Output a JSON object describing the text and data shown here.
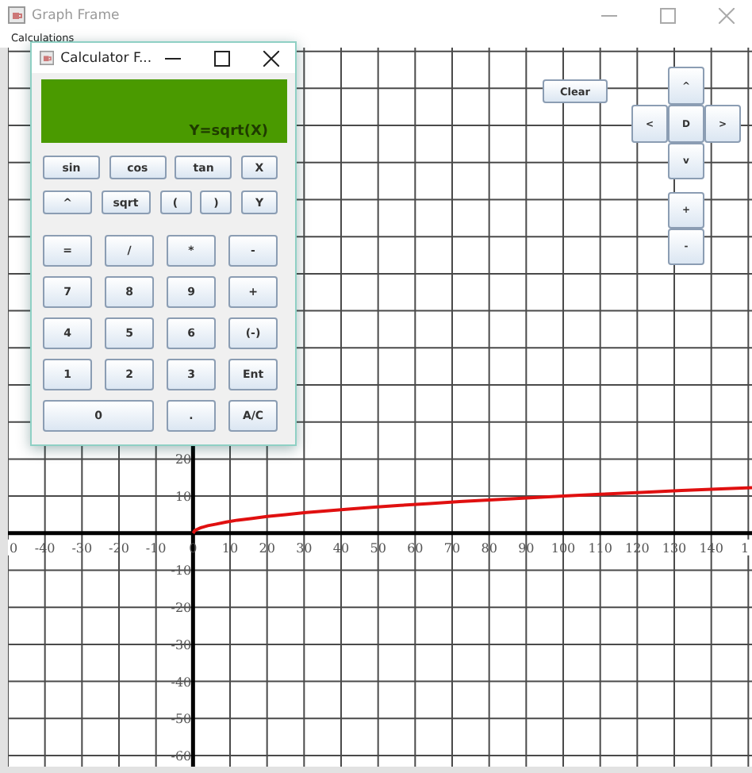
{
  "graph_window": {
    "title": "Graph Frame",
    "menu": [
      "Calculations"
    ],
    "plot": {
      "cut_tick_labels": [
        {
          "label": "0",
          "kind": "left"
        },
        {
          "label": "1",
          "kind": "right"
        }
      ],
      "chart_data": {
        "type": "line",
        "grid": true,
        "xlim": [
          -50,
          151
        ],
        "ylim": [
          -63,
          131
        ],
        "xticks": [
          -40,
          -30,
          -20,
          -10,
          0,
          10,
          20,
          30,
          40,
          50,
          60,
          70,
          80,
          90,
          100,
          110,
          120,
          130,
          140
        ],
        "yticks": [
          -60,
          -50,
          -40,
          -30,
          -20,
          -10,
          10,
          20
        ],
        "x": [
          0,
          0.5,
          1,
          2,
          4,
          6,
          9,
          12,
          16,
          20,
          25,
          30,
          36,
          42,
          49,
          56,
          64,
          72,
          81,
          90,
          100,
          110,
          121,
          132,
          144,
          151
        ],
        "series": [
          {
            "color": "#e01010",
            "values": [
              0,
              0.7,
              1,
              1.4,
              2,
              2.4,
              3,
              3.5,
              4,
              4.5,
              5,
              5.5,
              6,
              6.5,
              7,
              7.5,
              8,
              8.5,
              9,
              9.5,
              10,
              10.5,
              11,
              11.5,
              12,
              12.3
            ]
          }
        ]
      }
    },
    "clear_button": "Clear",
    "pad_buttons": [
      {
        "label": "^",
        "kind": "up"
      },
      {
        "label": "<",
        "kind": "left"
      },
      {
        "label": "D",
        "kind": "center"
      },
      {
        "label": ">",
        "kind": "right"
      },
      {
        "label": "v",
        "kind": "down"
      },
      {
        "label": "+",
        "kind": "plus"
      },
      {
        "label": "-",
        "kind": "minus"
      }
    ]
  },
  "calculator_window": {
    "title": "Calculator F...",
    "display": "Y=sqrt(X)",
    "function_rows": [
      [
        {
          "label": "sin",
          "kind": "function"
        },
        {
          "label": "cos",
          "kind": "function"
        },
        {
          "label": "tan",
          "kind": "function"
        },
        {
          "label": "X",
          "kind": "variable"
        }
      ],
      [
        {
          "label": "^",
          "kind": "operator"
        },
        {
          "label": "sqrt",
          "kind": "operator"
        },
        {
          "label": "(",
          "kind": "paren"
        },
        {
          "label": ")",
          "kind": "paren"
        },
        {
          "label": "Y",
          "kind": "variable"
        }
      ]
    ],
    "keypad": [
      {
        "label": "=",
        "kind": "key"
      },
      {
        "label": "/",
        "kind": "key"
      },
      {
        "label": "*",
        "kind": "key"
      },
      {
        "label": "-",
        "kind": "key"
      },
      {
        "label": "7",
        "kind": "key"
      },
      {
        "label": "8",
        "kind": "key"
      },
      {
        "label": "9",
        "kind": "key"
      },
      {
        "label": "+",
        "kind": "key"
      },
      {
        "label": "4",
        "kind": "key"
      },
      {
        "label": "5",
        "kind": "key"
      },
      {
        "label": "6",
        "kind": "key"
      },
      {
        "label": "(-)",
        "kind": "key"
      },
      {
        "label": "1",
        "kind": "key"
      },
      {
        "label": "2",
        "kind": "key"
      },
      {
        "label": "3",
        "kind": "key"
      },
      {
        "label": "Ent",
        "kind": "key"
      },
      {
        "label": "0",
        "kind": "wide"
      },
      {
        "label": ".",
        "kind": "key"
      },
      {
        "label": "A/C",
        "kind": "key"
      }
    ]
  }
}
